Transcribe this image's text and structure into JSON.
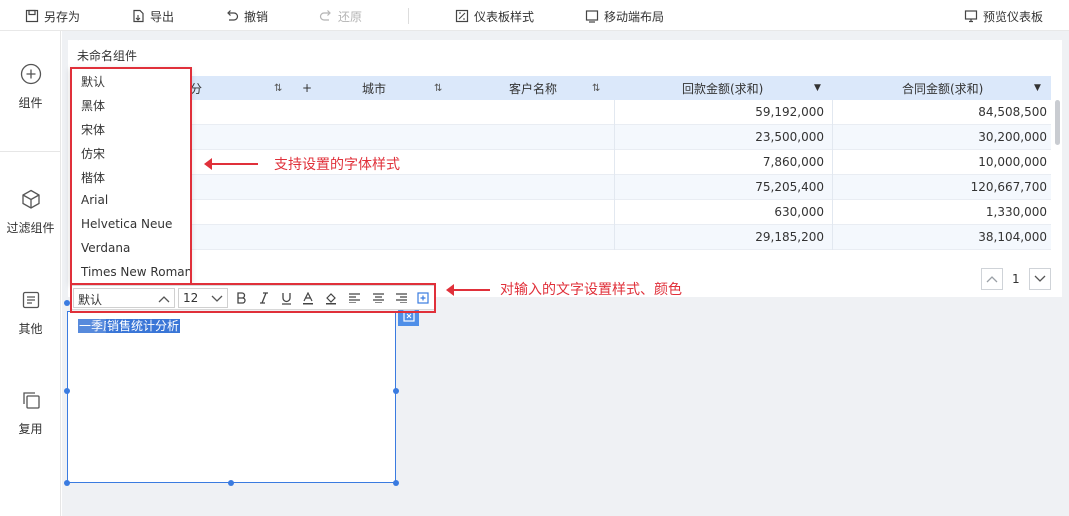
{
  "toolbar": {
    "save_as": "另存为",
    "export": "导出",
    "undo": "撤销",
    "redo": "还原",
    "dashboard_style": "仪表板样式",
    "mobile_layout": "移动端布局",
    "preview": "预览仪表板"
  },
  "sidebar": {
    "components": "组件",
    "filter_components": "过滤组件",
    "others": "其他",
    "reuse": "复用"
  },
  "widget": {
    "title": "未命名组件",
    "headers": {
      "col0_partial": "分",
      "add": "+",
      "city": "城市",
      "customer": "客户名称",
      "received": "回款金额(求和)",
      "contract": "合同金额(求和)"
    },
    "rows": [
      {
        "received": "59,192,000",
        "contract": "84,508,500"
      },
      {
        "received": "23,500,000",
        "contract": "30,200,000"
      },
      {
        "received": "7,860,000",
        "contract": "10,000,000"
      },
      {
        "received": "75,205,400",
        "contract": "120,667,700"
      },
      {
        "received": "630,000",
        "contract": "1,330,000"
      },
      {
        "received": "29,185,200",
        "contract": "38,104,000"
      }
    ],
    "page": "1"
  },
  "font_dropdown": {
    "options": [
      "默认",
      "黑体",
      "宋体",
      "仿宋",
      "楷体",
      "Arial",
      "Helvetica Neue",
      "Verdana",
      "Times New Roman"
    ]
  },
  "editor": {
    "font": "默认",
    "size": "12",
    "selected_text_prefix": "一季度",
    "selected_text": "销售统计分析"
  },
  "annotations": {
    "font_styles": "支持设置的字体样式",
    "text_styles": "对输入的文字设置样式、颜色"
  },
  "colors": {
    "accent": "#3a7be0",
    "annotation_red": "#e0303a",
    "header_bg": "#dbe8fa"
  }
}
